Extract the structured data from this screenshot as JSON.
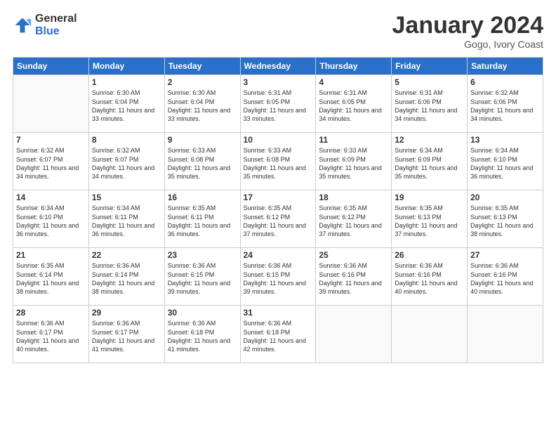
{
  "logo": {
    "general": "General",
    "blue": "Blue"
  },
  "title": {
    "month": "January 2024",
    "location": "Gogo, Ivory Coast"
  },
  "header_days": [
    "Sunday",
    "Monday",
    "Tuesday",
    "Wednesday",
    "Thursday",
    "Friday",
    "Saturday"
  ],
  "weeks": [
    [
      {
        "day": "",
        "sunrise": "",
        "sunset": "",
        "daylight": ""
      },
      {
        "day": "1",
        "sunrise": "Sunrise: 6:30 AM",
        "sunset": "Sunset: 6:04 PM",
        "daylight": "Daylight: 11 hours and 33 minutes."
      },
      {
        "day": "2",
        "sunrise": "Sunrise: 6:30 AM",
        "sunset": "Sunset: 6:04 PM",
        "daylight": "Daylight: 11 hours and 33 minutes."
      },
      {
        "day": "3",
        "sunrise": "Sunrise: 6:31 AM",
        "sunset": "Sunset: 6:05 PM",
        "daylight": "Daylight: 11 hours and 33 minutes."
      },
      {
        "day": "4",
        "sunrise": "Sunrise: 6:31 AM",
        "sunset": "Sunset: 6:05 PM",
        "daylight": "Daylight: 11 hours and 34 minutes."
      },
      {
        "day": "5",
        "sunrise": "Sunrise: 6:31 AM",
        "sunset": "Sunset: 6:06 PM",
        "daylight": "Daylight: 11 hours and 34 minutes."
      },
      {
        "day": "6",
        "sunrise": "Sunrise: 6:32 AM",
        "sunset": "Sunset: 6:06 PM",
        "daylight": "Daylight: 11 hours and 34 minutes."
      }
    ],
    [
      {
        "day": "7",
        "sunrise": "Sunrise: 6:32 AM",
        "sunset": "Sunset: 6:07 PM",
        "daylight": "Daylight: 11 hours and 34 minutes."
      },
      {
        "day": "8",
        "sunrise": "Sunrise: 6:32 AM",
        "sunset": "Sunset: 6:07 PM",
        "daylight": "Daylight: 11 hours and 34 minutes."
      },
      {
        "day": "9",
        "sunrise": "Sunrise: 6:33 AM",
        "sunset": "Sunset: 6:08 PM",
        "daylight": "Daylight: 11 hours and 35 minutes."
      },
      {
        "day": "10",
        "sunrise": "Sunrise: 6:33 AM",
        "sunset": "Sunset: 6:08 PM",
        "daylight": "Daylight: 11 hours and 35 minutes."
      },
      {
        "day": "11",
        "sunrise": "Sunrise: 6:33 AM",
        "sunset": "Sunset: 6:09 PM",
        "daylight": "Daylight: 11 hours and 35 minutes."
      },
      {
        "day": "12",
        "sunrise": "Sunrise: 6:34 AM",
        "sunset": "Sunset: 6:09 PM",
        "daylight": "Daylight: 11 hours and 35 minutes."
      },
      {
        "day": "13",
        "sunrise": "Sunrise: 6:34 AM",
        "sunset": "Sunset: 6:10 PM",
        "daylight": "Daylight: 11 hours and 36 minutes."
      }
    ],
    [
      {
        "day": "14",
        "sunrise": "Sunrise: 6:34 AM",
        "sunset": "Sunset: 6:10 PM",
        "daylight": "Daylight: 11 hours and 36 minutes."
      },
      {
        "day": "15",
        "sunrise": "Sunrise: 6:34 AM",
        "sunset": "Sunset: 6:11 PM",
        "daylight": "Daylight: 11 hours and 36 minutes."
      },
      {
        "day": "16",
        "sunrise": "Sunrise: 6:35 AM",
        "sunset": "Sunset: 6:11 PM",
        "daylight": "Daylight: 11 hours and 36 minutes."
      },
      {
        "day": "17",
        "sunrise": "Sunrise: 6:35 AM",
        "sunset": "Sunset: 6:12 PM",
        "daylight": "Daylight: 11 hours and 37 minutes."
      },
      {
        "day": "18",
        "sunrise": "Sunrise: 6:35 AM",
        "sunset": "Sunset: 6:12 PM",
        "daylight": "Daylight: 11 hours and 37 minutes."
      },
      {
        "day": "19",
        "sunrise": "Sunrise: 6:35 AM",
        "sunset": "Sunset: 6:13 PM",
        "daylight": "Daylight: 11 hours and 37 minutes."
      },
      {
        "day": "20",
        "sunrise": "Sunrise: 6:35 AM",
        "sunset": "Sunset: 6:13 PM",
        "daylight": "Daylight: 11 hours and 38 minutes."
      }
    ],
    [
      {
        "day": "21",
        "sunrise": "Sunrise: 6:35 AM",
        "sunset": "Sunset: 6:14 PM",
        "daylight": "Daylight: 11 hours and 38 minutes."
      },
      {
        "day": "22",
        "sunrise": "Sunrise: 6:36 AM",
        "sunset": "Sunset: 6:14 PM",
        "daylight": "Daylight: 11 hours and 38 minutes."
      },
      {
        "day": "23",
        "sunrise": "Sunrise: 6:36 AM",
        "sunset": "Sunset: 6:15 PM",
        "daylight": "Daylight: 11 hours and 39 minutes."
      },
      {
        "day": "24",
        "sunrise": "Sunrise: 6:36 AM",
        "sunset": "Sunset: 6:15 PM",
        "daylight": "Daylight: 11 hours and 39 minutes."
      },
      {
        "day": "25",
        "sunrise": "Sunrise: 6:36 AM",
        "sunset": "Sunset: 6:16 PM",
        "daylight": "Daylight: 11 hours and 39 minutes."
      },
      {
        "day": "26",
        "sunrise": "Sunrise: 6:36 AM",
        "sunset": "Sunset: 6:16 PM",
        "daylight": "Daylight: 11 hours and 40 minutes."
      },
      {
        "day": "27",
        "sunrise": "Sunrise: 6:36 AM",
        "sunset": "Sunset: 6:16 PM",
        "daylight": "Daylight: 11 hours and 40 minutes."
      }
    ],
    [
      {
        "day": "28",
        "sunrise": "Sunrise: 6:36 AM",
        "sunset": "Sunset: 6:17 PM",
        "daylight": "Daylight: 11 hours and 40 minutes."
      },
      {
        "day": "29",
        "sunrise": "Sunrise: 6:36 AM",
        "sunset": "Sunset: 6:17 PM",
        "daylight": "Daylight: 11 hours and 41 minutes."
      },
      {
        "day": "30",
        "sunrise": "Sunrise: 6:36 AM",
        "sunset": "Sunset: 6:18 PM",
        "daylight": "Daylight: 11 hours and 41 minutes."
      },
      {
        "day": "31",
        "sunrise": "Sunrise: 6:36 AM",
        "sunset": "Sunset: 6:18 PM",
        "daylight": "Daylight: 11 hours and 42 minutes."
      },
      {
        "day": "",
        "sunrise": "",
        "sunset": "",
        "daylight": ""
      },
      {
        "day": "",
        "sunrise": "",
        "sunset": "",
        "daylight": ""
      },
      {
        "day": "",
        "sunrise": "",
        "sunset": "",
        "daylight": ""
      }
    ]
  ]
}
